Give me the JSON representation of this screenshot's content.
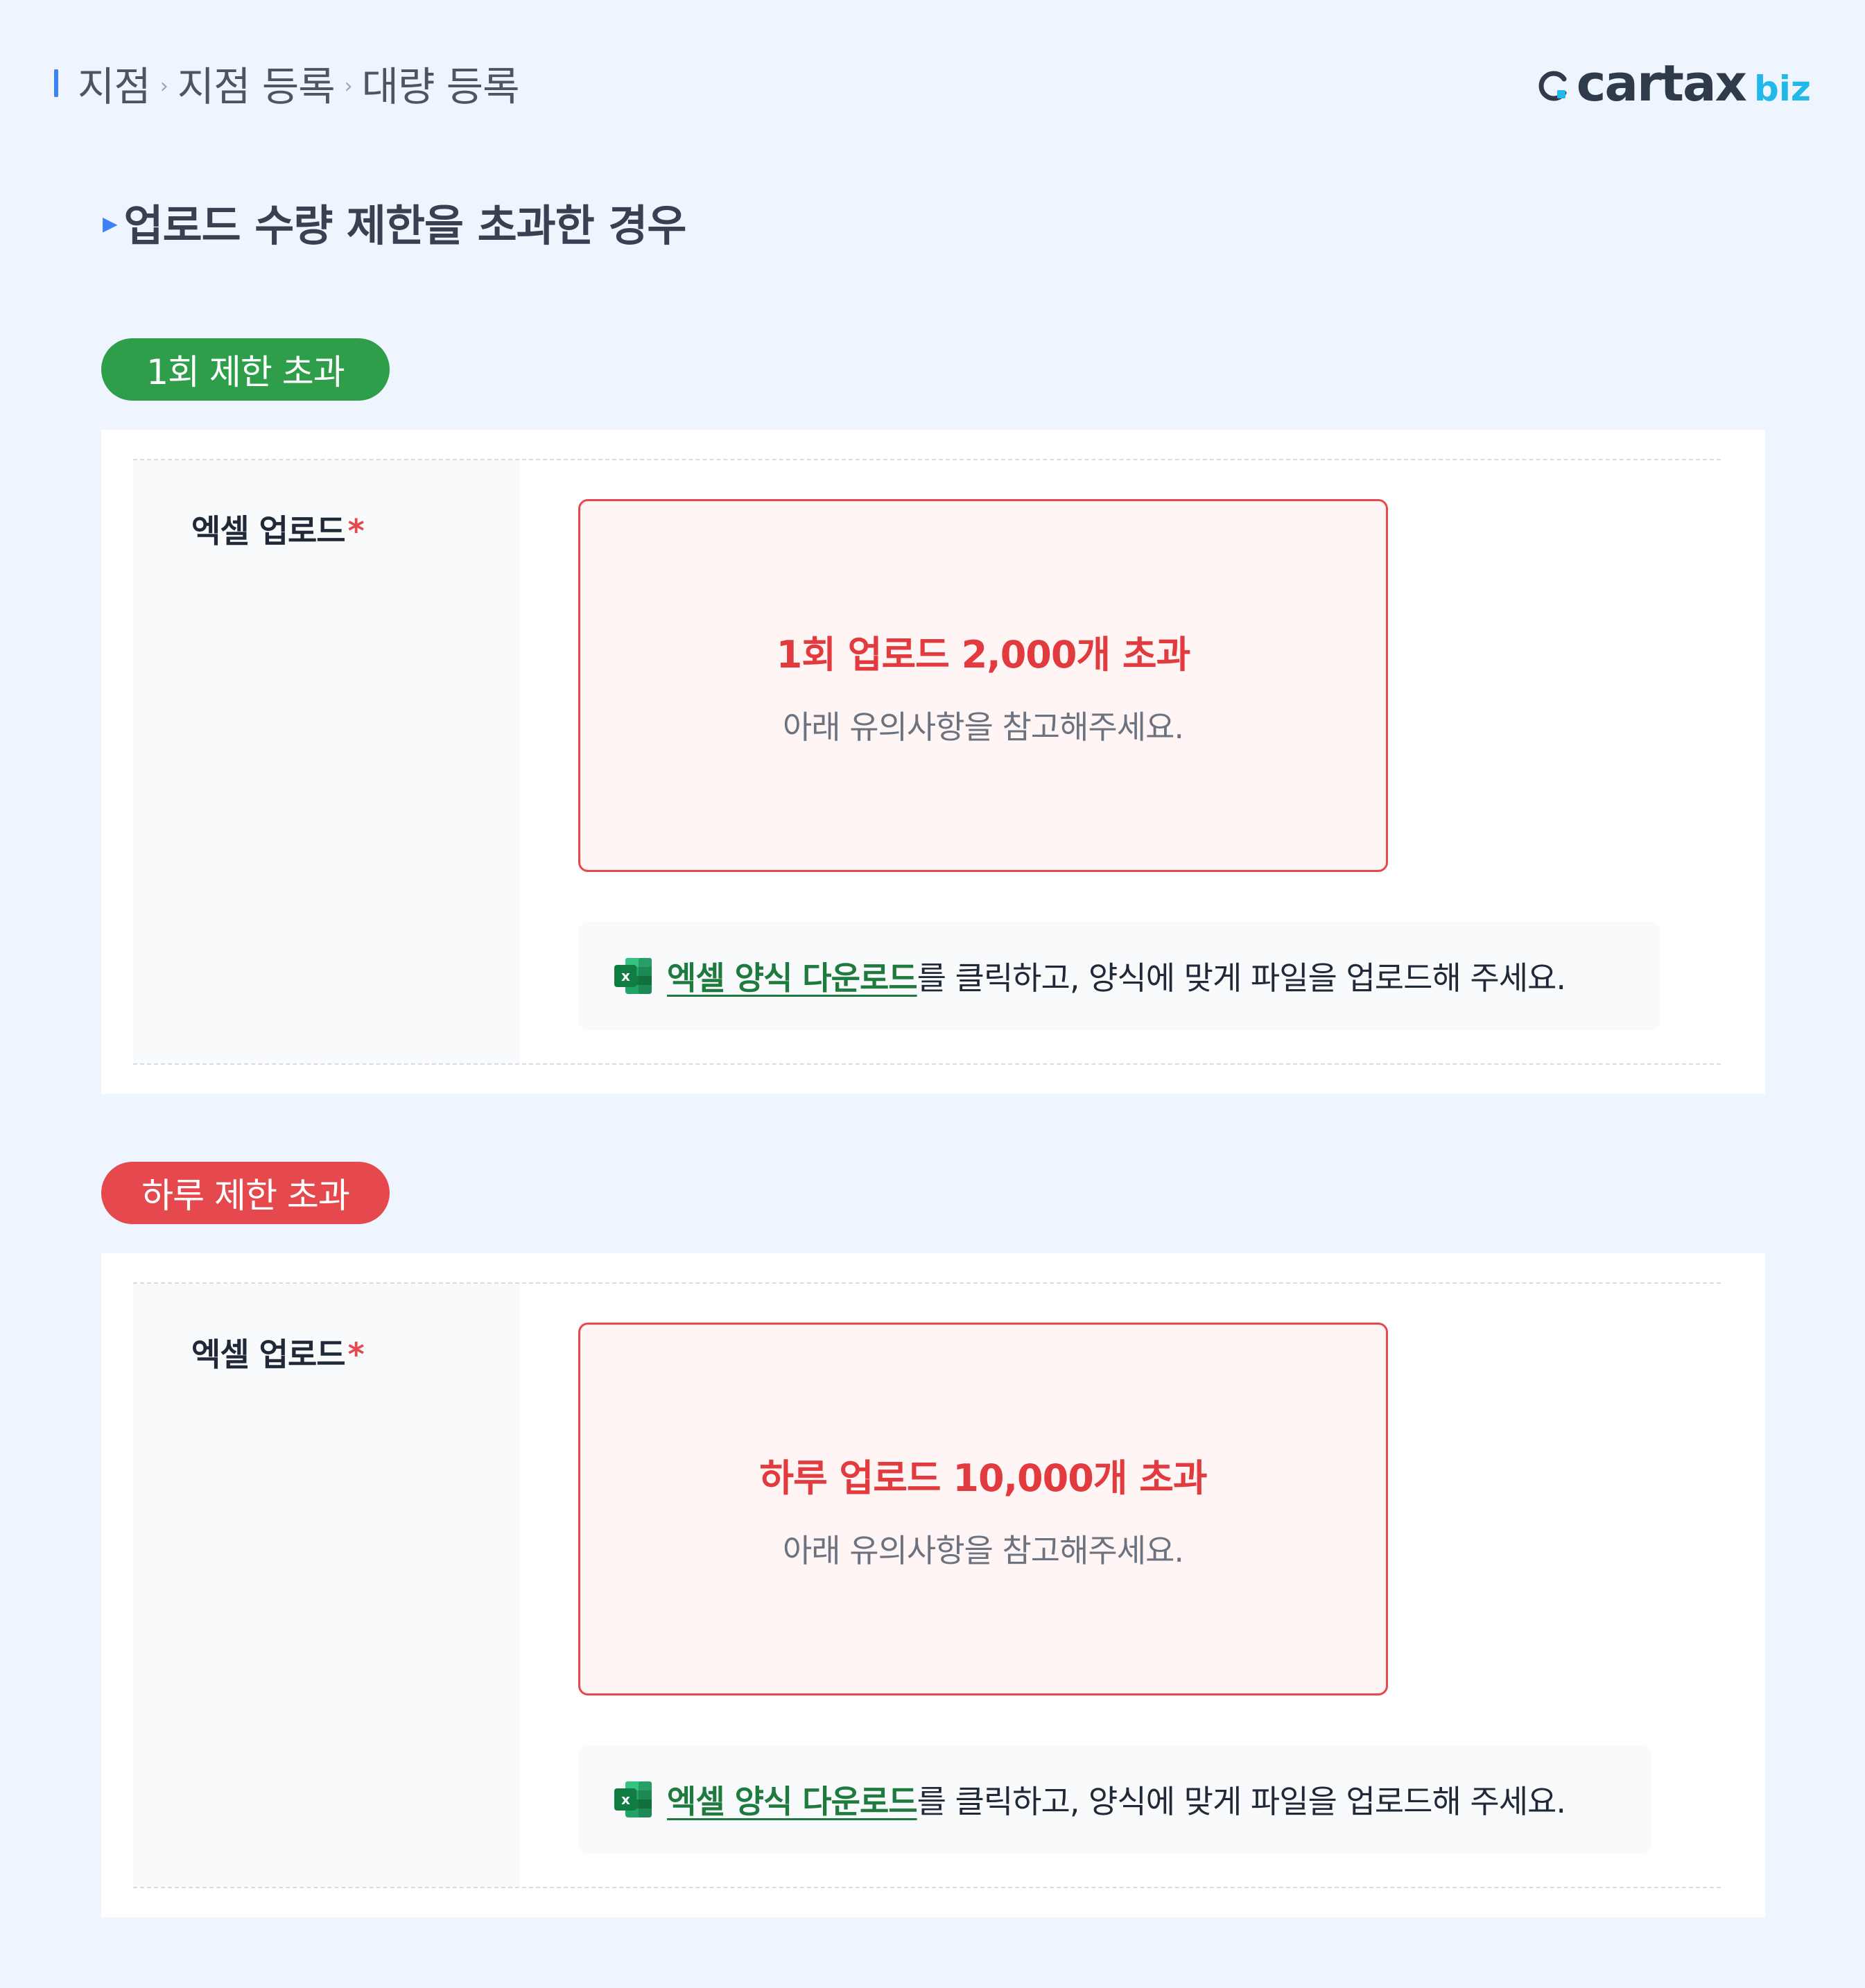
{
  "breadcrumb": {
    "items": [
      "지점",
      "지점 등록",
      "대량 등록"
    ],
    "separator": "›"
  },
  "logo": {
    "text": "cartax",
    "suffix": "biz",
    "brand_color": "#2F3A4A",
    "accent_color": "#22B8E8"
  },
  "page": {
    "heading": "업로드 수량 제한을 초과한 경우"
  },
  "sections": [
    {
      "badge": "1회 제한 초과",
      "badge_color": "#2E9E4A",
      "field_label": "엑셀 업로드",
      "required": "*",
      "error_title": "1회 업로드 2,000개 초과",
      "error_subtitle": "아래 유의사항을 참고해주세요.",
      "download_link": "엑셀 양식 다운로드",
      "info_text": "를 클릭하고, 양식에 맞게 파일을 업로드해 주세요."
    },
    {
      "badge": "하루 제한 초과",
      "badge_color": "#E5484D",
      "field_label": "엑셀 업로드",
      "required": "*",
      "error_title": "하루 업로드 10,000개 초과",
      "error_subtitle": "아래 유의사항을 참고해주세요.",
      "download_link": "엑셀 양식 다운로드",
      "info_text": "를 클릭하고, 양식에 맞게 파일을 업로드해 주세요."
    }
  ],
  "colors": {
    "error": "#E5484D",
    "link": "#1F7A3E",
    "background": "#EEF5FE"
  },
  "icons": [
    "excel-icon",
    "chevron-right-icon"
  ]
}
